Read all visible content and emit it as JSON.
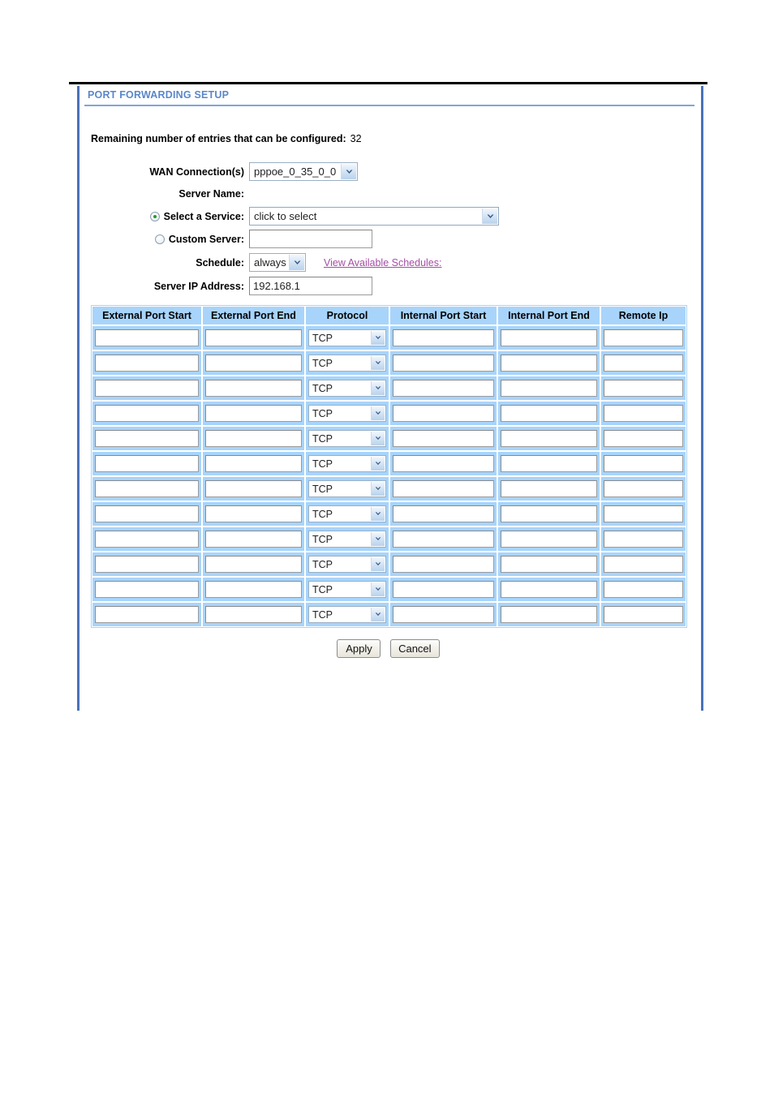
{
  "panel": {
    "title": "PORT FORWARDING SETUP"
  },
  "form": {
    "remaining_label": "Remaining number of entries that can be configured:",
    "remaining_count": "32",
    "wan_label": "WAN Connection(s)",
    "wan_value": "pppoe_0_35_0_0",
    "server_name_label": "Server Name:",
    "select_service_label": "Select a Service:",
    "select_service_value": "click to select",
    "custom_server_label": "Custom Server:",
    "custom_server_value": "",
    "schedule_label": "Schedule:",
    "schedule_value": "always",
    "schedule_link": "View Available Schedules:",
    "server_ip_label": "Server IP Address:",
    "server_ip_value": "192.168.1"
  },
  "table": {
    "headers": [
      "External Port Start",
      "External Port End",
      "Protocol",
      "Internal Port Start",
      "Internal Port End",
      "Remote Ip"
    ],
    "rows": [
      {
        "external_port_start": "",
        "external_port_end": "",
        "protocol": "TCP",
        "internal_port_start": "",
        "internal_port_end": "",
        "remote_ip": ""
      },
      {
        "external_port_start": "",
        "external_port_end": "",
        "protocol": "TCP",
        "internal_port_start": "",
        "internal_port_end": "",
        "remote_ip": ""
      },
      {
        "external_port_start": "",
        "external_port_end": "",
        "protocol": "TCP",
        "internal_port_start": "",
        "internal_port_end": "",
        "remote_ip": ""
      },
      {
        "external_port_start": "",
        "external_port_end": "",
        "protocol": "TCP",
        "internal_port_start": "",
        "internal_port_end": "",
        "remote_ip": ""
      },
      {
        "external_port_start": "",
        "external_port_end": "",
        "protocol": "TCP",
        "internal_port_start": "",
        "internal_port_end": "",
        "remote_ip": ""
      },
      {
        "external_port_start": "",
        "external_port_end": "",
        "protocol": "TCP",
        "internal_port_start": "",
        "internal_port_end": "",
        "remote_ip": ""
      },
      {
        "external_port_start": "",
        "external_port_end": "",
        "protocol": "TCP",
        "internal_port_start": "",
        "internal_port_end": "",
        "remote_ip": ""
      },
      {
        "external_port_start": "",
        "external_port_end": "",
        "protocol": "TCP",
        "internal_port_start": "",
        "internal_port_end": "",
        "remote_ip": ""
      },
      {
        "external_port_start": "",
        "external_port_end": "",
        "protocol": "TCP",
        "internal_port_start": "",
        "internal_port_end": "",
        "remote_ip": ""
      },
      {
        "external_port_start": "",
        "external_port_end": "",
        "protocol": "TCP",
        "internal_port_start": "",
        "internal_port_end": "",
        "remote_ip": ""
      },
      {
        "external_port_start": "",
        "external_port_end": "",
        "protocol": "TCP",
        "internal_port_start": "",
        "internal_port_end": "",
        "remote_ip": ""
      },
      {
        "external_port_start": "",
        "external_port_end": "",
        "protocol": "TCP",
        "internal_port_start": "",
        "internal_port_end": "",
        "remote_ip": ""
      }
    ]
  },
  "buttons": {
    "apply": "Apply",
    "cancel": "Cancel"
  },
  "colors": {
    "panel_title": "#5a87c8",
    "rail": "#4a72b8",
    "table_blue": "#a8d4fb",
    "link_purple": "#a64ca6",
    "radio_dot_green": "#1e9e24"
  }
}
